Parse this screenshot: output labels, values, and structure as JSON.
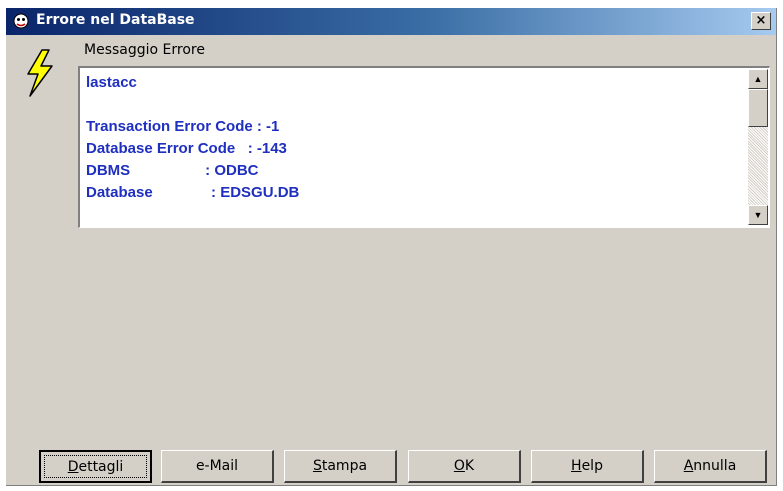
{
  "window": {
    "title": "Errore nel DataBase",
    "close_label": "×"
  },
  "message": {
    "label": "Messaggio Errore",
    "lines": [
      "lastacc",
      "",
      "Transaction Error Code : -1",
      "Database Error Code   : -143",
      "DBMS                  : ODBC",
      "Database              : EDSGU.DB"
    ]
  },
  "buttons": {
    "details": {
      "mnemonic": "D",
      "rest": "ettagli"
    },
    "email": {
      "label": "e-Mail"
    },
    "print": {
      "mnemonic": "S",
      "rest": "tampa"
    },
    "ok": {
      "mnemonic": "O",
      "rest": "K"
    },
    "help": {
      "mnemonic": "H",
      "rest": "elp"
    },
    "cancel": {
      "mnemonic": "A",
      "rest": "nnulla"
    }
  },
  "colors": {
    "title_bar_start": "#0a246a",
    "title_bar_end": "#a6caf0",
    "message_text": "#1f2fbf",
    "dialog_face": "#d4d0c8"
  },
  "icons": {
    "title": "app-icon",
    "error": "lightning-bolt-icon"
  }
}
